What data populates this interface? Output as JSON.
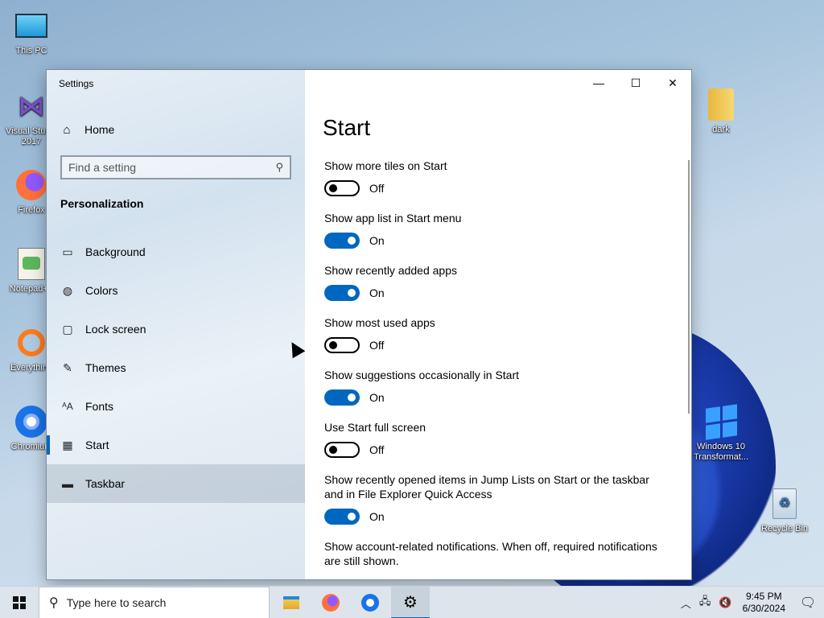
{
  "desktop": {
    "icons": [
      {
        "label": "This PC",
        "icon": "monitor-icon"
      },
      {
        "label": "Visual Studio 2017",
        "icon": "visual-studio-icon"
      },
      {
        "label": "Firefox",
        "icon": "firefox-icon"
      },
      {
        "label": "Notepad++",
        "icon": "notepad-icon"
      },
      {
        "label": "Everything",
        "icon": "search-icon"
      },
      {
        "label": "Chromium",
        "icon": "chromium-icon"
      },
      {
        "label": "dark",
        "icon": "folder-icon"
      },
      {
        "label": "Windows 10 Transformat...",
        "icon": "windows-logo-icon"
      },
      {
        "label": "Recycle Bin",
        "icon": "recycle-bin-icon"
      }
    ]
  },
  "window": {
    "app_title": "Settings",
    "controls": {
      "minimize": "—",
      "maximize": "☐",
      "close": "✕"
    }
  },
  "sidebar": {
    "home_label": "Home",
    "search_placeholder": "Find a setting",
    "section_title": "Personalization",
    "items": [
      {
        "label": "Background",
        "icon": "picture-icon"
      },
      {
        "label": "Colors",
        "icon": "palette-icon"
      },
      {
        "label": "Lock screen",
        "icon": "lock-screen-icon"
      },
      {
        "label": "Themes",
        "icon": "brush-icon"
      },
      {
        "label": "Fonts",
        "icon": "font-icon"
      },
      {
        "label": "Start",
        "icon": "start-tiles-icon"
      },
      {
        "label": "Taskbar",
        "icon": "taskbar-icon"
      }
    ]
  },
  "content": {
    "page_title": "Start",
    "settings": [
      {
        "label": "Show more tiles on Start",
        "state": "Off"
      },
      {
        "label": "Show app list in Start menu",
        "state": "On"
      },
      {
        "label": "Show recently added apps",
        "state": "On"
      },
      {
        "label": "Show most used apps",
        "state": "Off"
      },
      {
        "label": "Show suggestions occasionally in Start",
        "state": "On"
      },
      {
        "label": "Use Start full screen",
        "state": "Off"
      },
      {
        "label": "Show recently opened items in Jump Lists on Start or the taskbar and in File Explorer Quick Access",
        "state": "On"
      },
      {
        "label": "Show account-related notifications. When off, required notifications are still shown.",
        "state": ""
      }
    ]
  },
  "taskbar": {
    "search_placeholder": "Type here to search",
    "apps": [
      "file-explorer-icon",
      "firefox-icon",
      "chromium-icon",
      "settings-gear-icon"
    ],
    "time": "9:45 PM",
    "date": "6/30/2024"
  },
  "colors": {
    "accent": "#0067c0"
  }
}
